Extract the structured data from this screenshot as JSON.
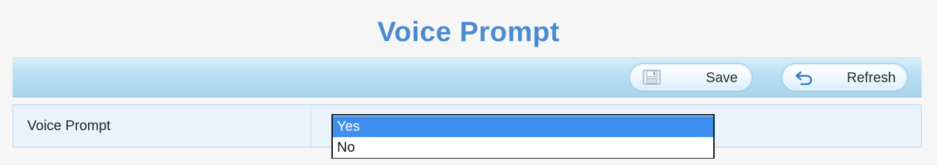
{
  "page": {
    "title": "Voice Prompt"
  },
  "toolbar": {
    "save_label": "Save",
    "save_icon": "save-icon",
    "refresh_label": "Refresh",
    "refresh_icon": "refresh-icon"
  },
  "settings": {
    "voice_prompt": {
      "label": "Voice Prompt",
      "options": [
        "Yes",
        "No"
      ],
      "selected": "Yes"
    }
  },
  "colors": {
    "title": "#4a8ad0",
    "toolbar_band": "#b8def1",
    "row_background": "#e9f3fb",
    "selected_option": "#3f8eef"
  }
}
